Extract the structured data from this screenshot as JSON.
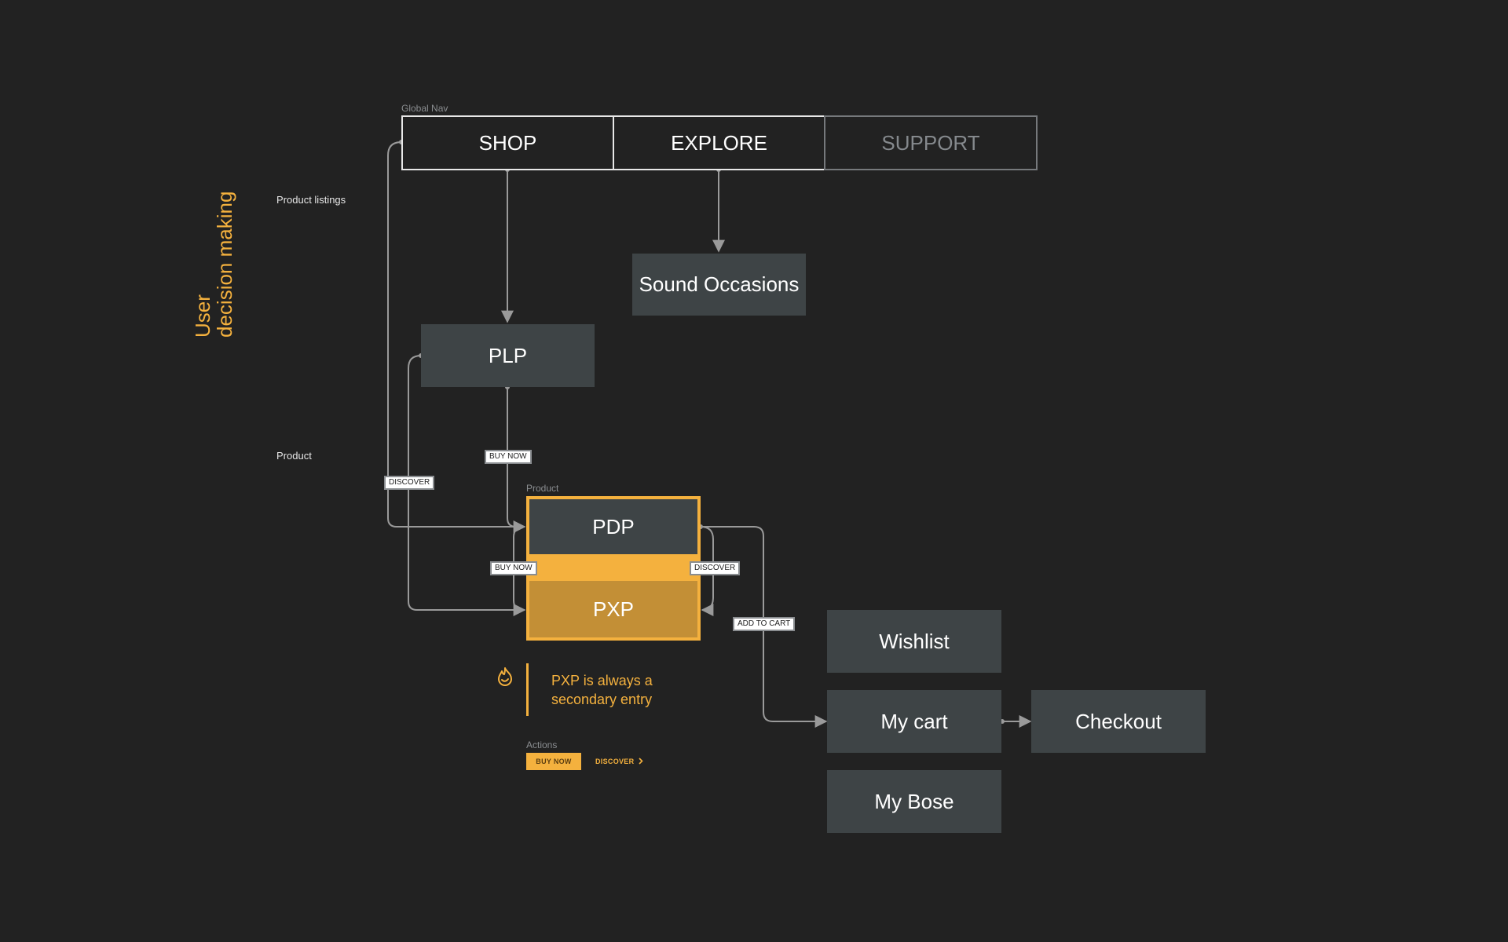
{
  "side_title": {
    "line1": "User",
    "line2": "decision making"
  },
  "row_labels": {
    "product_listings": "Product listings",
    "product": "Product"
  },
  "global_nav": {
    "label": "Global Nav",
    "items": [
      {
        "label": "SHOP",
        "state": "active"
      },
      {
        "label": "EXPLORE",
        "state": "active"
      },
      {
        "label": "SUPPORT",
        "state": "muted"
      }
    ]
  },
  "nodes": {
    "sound_occasions": "Sound Occasions",
    "plp": "PLP",
    "pdp": "PDP",
    "pxp": "PXP",
    "wishlist": "Wishlist",
    "my_cart": "My cart",
    "checkout": "Checkout",
    "my_bose": "My Bose"
  },
  "product_group": {
    "label": "Product"
  },
  "edge_labels": {
    "plp_to_pdp": "BUY NOW",
    "nav_to_pdp": "DISCOVER",
    "pdp_to_pxp_left": "BUY NOW",
    "pdp_to_pxp_right": "DISCOVER",
    "pdp_to_cart": "ADD TO CART"
  },
  "note": {
    "icon": "flame-icon",
    "text_line1": "PXP is always a",
    "text_line2": "secondary entry"
  },
  "actions": {
    "label": "Actions",
    "primary": "BUY NOW",
    "secondary": "DISCOVER",
    "secondary_icon": "chevron-right-icon"
  },
  "colors": {
    "background": "#222222",
    "accent": "#f4b13e",
    "node": "#3e4446",
    "pxp": "#c38f36",
    "connector": "#9a9a9a"
  }
}
